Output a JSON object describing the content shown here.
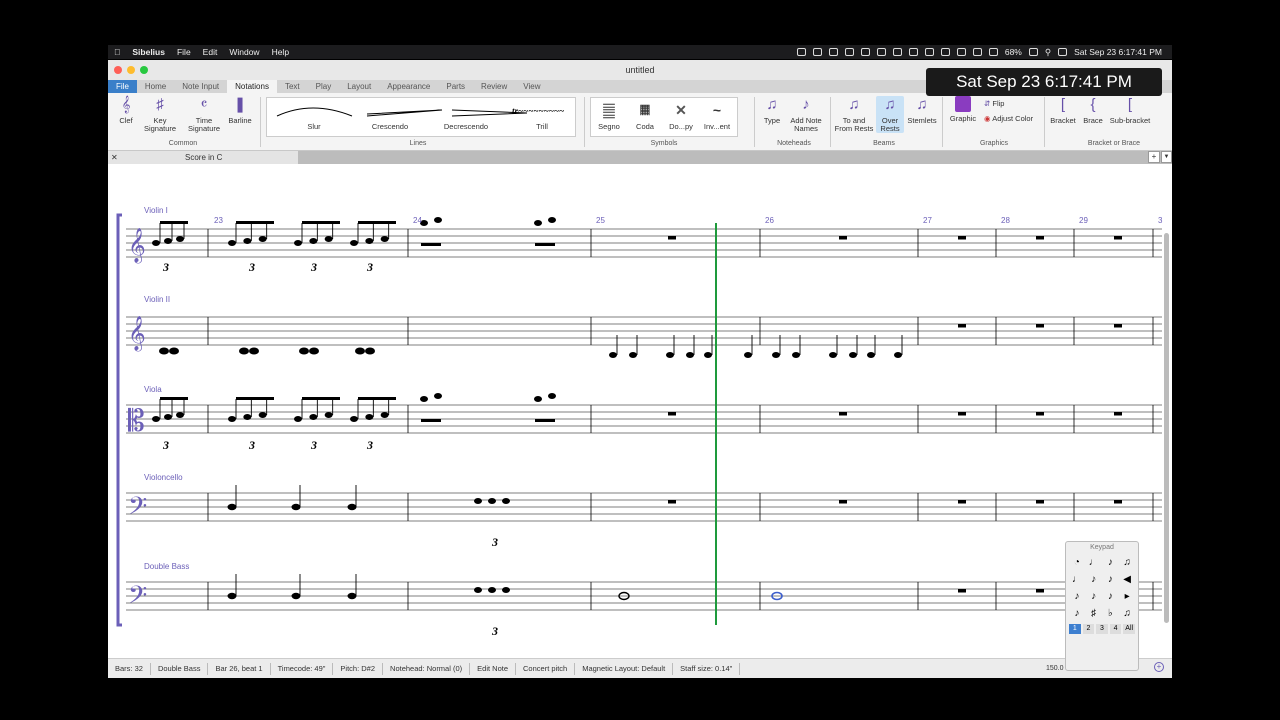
{
  "menubar": {
    "apple": "",
    "app": "Sibelius",
    "items": [
      "File",
      "Edit",
      "Window",
      "Help"
    ],
    "battery": "68%",
    "datetime": "Sat Sep 23  6:17:41 PM"
  },
  "clock_overlay": "Sat Sep 23  6:17:41 PM",
  "window": {
    "title": "untitled"
  },
  "ribbon_tabs": [
    "File",
    "Home",
    "Note Input",
    "Notations",
    "Text",
    "Play",
    "Layout",
    "Appearance",
    "Parts",
    "Review",
    "View"
  ],
  "ribbon": {
    "common": {
      "label": "Common",
      "clef": "Clef",
      "key": "Key\nSignature",
      "time": "Time\nSignature",
      "barline": "Barline"
    },
    "lines": {
      "label": "Lines",
      "items": [
        "Slur",
        "Crescendo",
        "Decrescendo",
        "Trill"
      ]
    },
    "symbols": {
      "label": "Symbols",
      "items": [
        "Segno",
        "Coda",
        "Do...py",
        "Inv...ent"
      ]
    },
    "noteheads": {
      "label": "Noteheads",
      "type": "Type",
      "add_names": "Add Note\nNames"
    },
    "beams": {
      "label": "Beams",
      "to_from_rests": "To and\nFrom Rests",
      "over_rests": "Over\nRests",
      "stemlets": "Stemlets"
    },
    "graphics": {
      "label": "Graphics",
      "graphic": "Graphic",
      "flip": "Flip",
      "adjust_color": "Adjust Color"
    },
    "bracket": {
      "label": "Bracket or Brace",
      "bracket": "Bracket",
      "brace": "Brace",
      "sub_bracket": "Sub-bracket"
    }
  },
  "document_tab": "Score in C",
  "score": {
    "instruments": [
      "Violin I",
      "Violin II",
      "Viola",
      "Violoncello",
      "Double Bass"
    ],
    "bar_numbers": [
      "23",
      "24",
      "25",
      "26",
      "27",
      "28",
      "29",
      "3"
    ],
    "tuplet": "3"
  },
  "status": {
    "bars": "Bars: 32",
    "instrument": "Double Bass",
    "position": "Bar 26, beat 1",
    "timecode": "Timecode: 49\"",
    "pitch": "Pitch: D#2",
    "notehead": "Notehead: Normal (0)",
    "mode": "Edit Note",
    "concert": "Concert pitch",
    "magnetic": "Magnetic Layout: Default",
    "staff_size": "Staff size: 0.14\"",
    "zoom": "150.0"
  },
  "keypad": {
    "title": "Keypad",
    "tabs": [
      "1",
      "2",
      "3",
      "4",
      "All"
    ]
  }
}
